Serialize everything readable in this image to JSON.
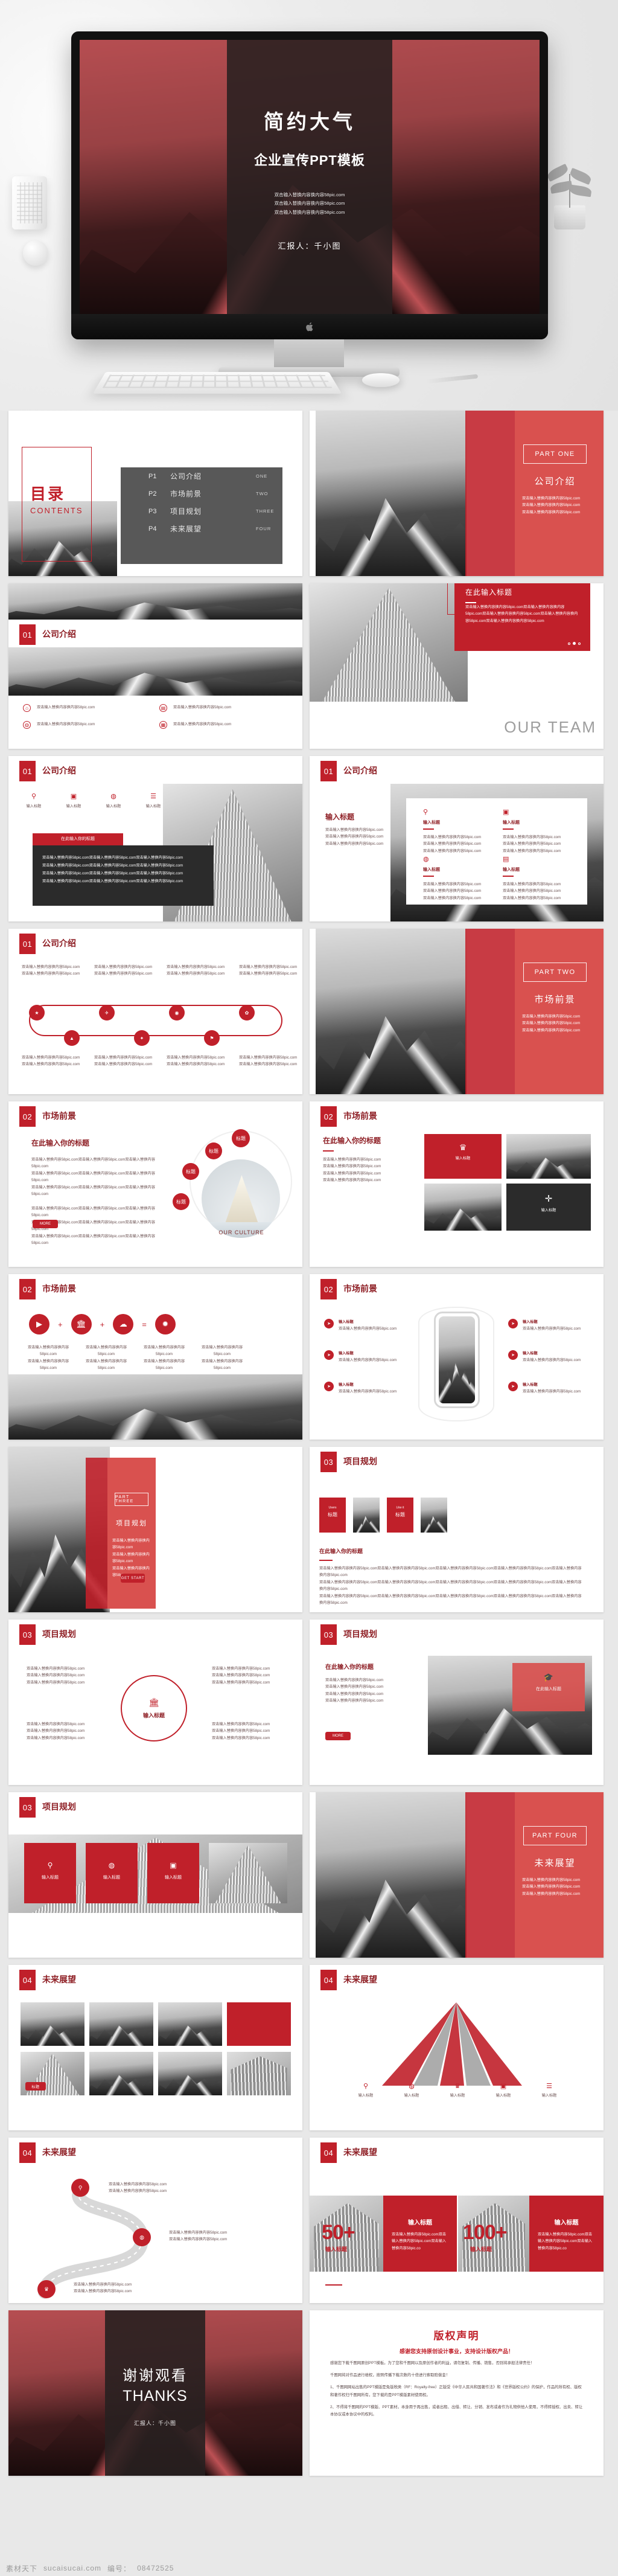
{
  "meta": {
    "cover_title": "简约大气",
    "cover_subtitle": "企业宣传PPT模板",
    "cover_lines": [
      "双击输入替换内容换内容58pic.com",
      "双击输入替换内容换内容58pic.com",
      "双击输入替换内容换内容58pic.com"
    ],
    "presenter": "汇报人：千小图"
  },
  "watermark": {
    "brand": "素材天下",
    "site": "sucaisucai.com",
    "id_label": "编号：",
    "id_value": "08472525"
  },
  "body_line": "双击输入替换内容换内容58pic.com",
  "body_long": "双击输入替换内容换内容58pic.com双击输入替换内容换内容58pic.com双击输入替换内容换内容58pic.com双击输入替换内容换内容58pic.com双击输入替换内容换内容58pic.com",
  "body_mid": "双击输入替换内容58pic.com双击输入替换内容58pic.com双击输入替换内容58pic.com",
  "labels": {
    "input_title": "输入标题",
    "enter_title_here": "在此输入标题",
    "enter_your_title": "在此输入你的标题",
    "title_short": "标题",
    "more": "MORE",
    "get_start": "GET START",
    "our_team": "OUR TEAM",
    "our_culture": "OUR CULTURE",
    "users": "Users",
    "like_it": "Like it"
  },
  "toc": {
    "cn": "目录",
    "en": "CONTENTS",
    "items": [
      {
        "page": "P1",
        "title": "公司介绍",
        "num": "ONE"
      },
      {
        "page": "P2",
        "title": "市场前景",
        "num": "TWO"
      },
      {
        "page": "P3",
        "title": "项目规划",
        "num": "THREE"
      },
      {
        "page": "P4",
        "title": "未来展望",
        "num": "FOUR"
      }
    ]
  },
  "parts": [
    {
      "en": "PART ONE",
      "cn": "公司介绍"
    },
    {
      "en": "PART TWO",
      "cn": "市场前景"
    },
    {
      "en": "PART THREE",
      "cn": "项目规划"
    },
    {
      "en": "PART FOUR",
      "cn": "未来展望"
    }
  ],
  "sections": {
    "s1": {
      "num": "01",
      "title": "公司介绍"
    },
    "s2": {
      "num": "02",
      "title": "市场前景"
    },
    "s3": {
      "num": "03",
      "title": "项目规划"
    },
    "s4": {
      "num": "04",
      "title": "未来展望"
    }
  },
  "stats": [
    {
      "value": "50+",
      "caption": "输入标题",
      "title": "输入标题",
      "text": "双击输入替换内容58pic.com双击输入替换内容58pic.com双击输入替换内容58pic.co"
    },
    {
      "value": "100+",
      "caption": "输入标题",
      "title": "输入标题",
      "text": "双击输入替换内容58pic.com双击输入替换内容58pic.com双击输入替换内容58pic.co"
    }
  ],
  "thanks": {
    "cn": "谢谢观看",
    "en": "THANKS",
    "presenter": "汇报人：千小图"
  },
  "copyright": {
    "title": "版权声明",
    "subtitle": "感谢您支持原创设计事业，支持设计版权产品！",
    "paras": [
      "感谢您下载千图网原创PPT模板。为了您和千图网以及原创作者的利益，请勿复制、传播、销售，否则将承担法律责任！",
      "千图网将对作品进行维权，按照传播下载次数的十倍进行索取赔偿金！",
      "1、千图网网站出售的PPT模版是免版税类（RF：Royalty-free）正版受《中华人民共和国著作法》和《世界版权公约》的保护，作品的所有权、版权和著作权归千图网所有，您下载的是PPT模版素材使用权。",
      "2、不得将千图网的PPT模版、PPT素材，本身用于再出售，或者出租、出借、转让、分销、发布或者作为礼物供他人使用，不得转授权、出卖、转让本协议或本协议中的权利。"
    ]
  },
  "colors": {
    "accent": "#c0202a",
    "accent_soft": "#d9514f",
    "dark": "#2b2b2b",
    "text": "#6a5050"
  }
}
